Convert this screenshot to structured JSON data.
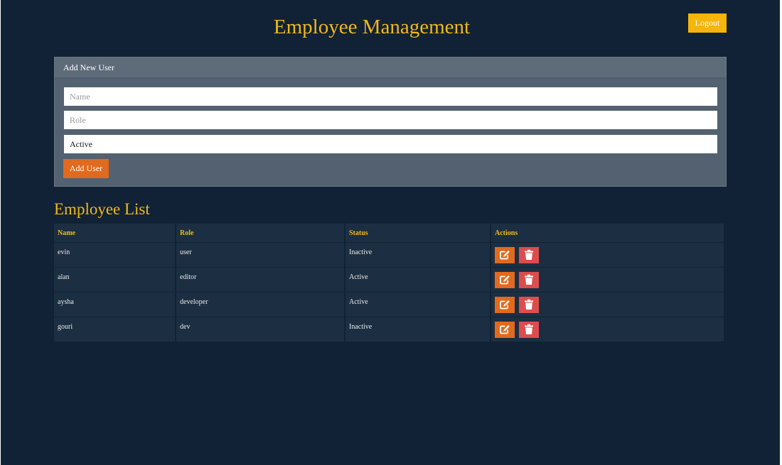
{
  "header": {
    "title": "Employee Management",
    "logout_label": "Logout"
  },
  "add_form": {
    "heading": "Add New User",
    "name_placeholder": "Name",
    "role_placeholder": "Role",
    "status_value": "Active",
    "submit_label": "Add User"
  },
  "list": {
    "title": "Employee List",
    "columns": [
      "Name",
      "Role",
      "Status",
      "Actions"
    ],
    "rows": [
      {
        "name": "evin",
        "role": "user",
        "status": "Inactive"
      },
      {
        "name": "alan",
        "role": "editor",
        "status": "Active"
      },
      {
        "name": "aysha",
        "role": "developer",
        "status": "Active"
      },
      {
        "name": "gouri",
        "role": "dev",
        "status": "Inactive"
      }
    ],
    "row_actions": [
      "edit-icon",
      "trash-icon"
    ]
  },
  "colors": {
    "background": "#112236",
    "accent_yellow": "#f0b81a",
    "logout_button": "#f5b50a",
    "primary_orange": "#e06a1e",
    "danger_red": "#dc4d4d",
    "panel": "#536170",
    "table_cell": "#1c2f42"
  }
}
